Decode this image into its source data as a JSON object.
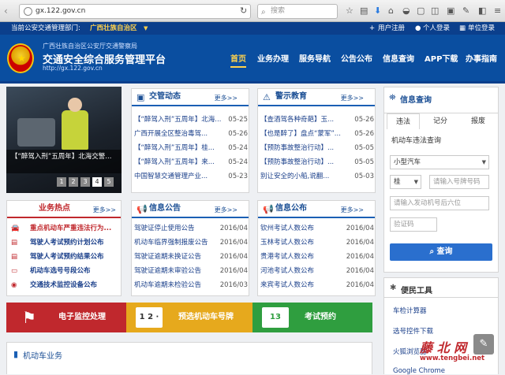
{
  "browser": {
    "url": "gx.122.gov.cn",
    "search_placeholder": "搜索"
  },
  "topbar": {
    "dept_label": "当前公安交通管理部门:",
    "dept_value": "广西壮族自治区",
    "register": "用户注册",
    "personal_login": "个人登录",
    "unit_login": "单位登录"
  },
  "header": {
    "org": "广西壮族自治区公安厅交通警察局",
    "title": "交通安全综合服务管理平台",
    "url": "http://gx.122.gov.cn"
  },
  "nav": [
    "首页",
    "业务办理",
    "服务导航",
    "公告公布",
    "信息查询",
    "APP下载",
    "办事指南"
  ],
  "slide": {
    "caption": "【“醉驾入刑”五周年】北海交警...",
    "pages": [
      "1",
      "2",
      "3",
      "4",
      "5"
    ],
    "active_page": "4"
  },
  "traffic_news": {
    "title": "交管动态",
    "more": "更多>>",
    "items": [
      {
        "text": "【“醉驾入刑”五周年】北海...",
        "date": "05-25"
      },
      {
        "text": "广西开展全区整治毒驾...",
        "date": "05-26"
      },
      {
        "text": "【“醉驾入刑”五周年】桂...",
        "date": "05-24"
      },
      {
        "text": "【“醉驾入刑”五周年】来...",
        "date": "05-24"
      },
      {
        "text": "中国智慧交通管理产业...",
        "date": "05-23"
      }
    ]
  },
  "warning_edu": {
    "title": "警示教育",
    "more": "更多>>",
    "items": [
      {
        "text": "【查酒驾各种奇葩】玉...",
        "date": "05-26"
      },
      {
        "text": "【也是醉了】盘点“蒙军”...",
        "date": "05-26"
      },
      {
        "text": "【预防事故整治行动】...",
        "date": "05-05"
      },
      {
        "text": "【预防事故整治行动】...",
        "date": "05-05"
      },
      {
        "text": "别让安全的小船,说翻...",
        "date": "05-03"
      }
    ]
  },
  "hot_business": {
    "title": "业务热点",
    "more": "更多>>",
    "items": [
      "重点机动车严重违法行为...",
      "驾驶人考试预约计划公布",
      "驾驶人考试预约结果公布",
      "机动车选号号段公布",
      "交通技术监控设备公布"
    ]
  },
  "info_notice": {
    "title": "信息公告",
    "more": "更多>>",
    "items": [
      {
        "text": "驾驶证停止使用公告",
        "date": "2016/04"
      },
      {
        "text": "机动车临界强制报废公告",
        "date": "2016/04"
      },
      {
        "text": "驾驶证逾期未换证公告",
        "date": "2016/04"
      },
      {
        "text": "驾驶证逾期未审验公告",
        "date": "2016/04"
      },
      {
        "text": "机动车逾期未检验公告",
        "date": "2016/03"
      }
    ]
  },
  "info_publish": {
    "title": "信息公布",
    "more": "更多>>",
    "items": [
      {
        "text": "钦州考试人数公布",
        "date": "2016/04"
      },
      {
        "text": "玉林考试人数公布",
        "date": "2016/04"
      },
      {
        "text": "贵港考试人数公布",
        "date": "2016/04"
      },
      {
        "text": "河池考试人数公布",
        "date": "2016/04"
      },
      {
        "text": "来宾考试人数公布",
        "date": "2016/04"
      }
    ]
  },
  "banners": [
    {
      "label": "电子监控处理",
      "color": "#c0282d",
      "icon": "flag-icon"
    },
    {
      "label": "预选机动车号牌",
      "color": "#e6a91d",
      "icon": "plate-icon",
      "icon_text": "1 2 ·"
    },
    {
      "label": "考试预约",
      "color": "#2f9e3f",
      "icon": "calendar-icon",
      "icon_text": "13"
    }
  ],
  "motor_business": {
    "title": "机动车业务"
  },
  "query": {
    "title": "信息查询",
    "tabs": [
      "违法",
      "记分",
      "报废"
    ],
    "subtitle": "机动车违法查询",
    "vehicle_type": "小型汽车",
    "province": "桂",
    "plate_placeholder": "请输入号牌号码",
    "engine_placeholder": "请输入发动机号后六位",
    "captcha_placeholder": "验证码",
    "submit": "查询"
  },
  "tools": {
    "title": "便民工具",
    "items": [
      "车检计算器",
      "选号控件下载",
      "火狐浏览器",
      "Google Chrome"
    ]
  },
  "watermark": {
    "brand": "藤 北 网",
    "site": "www.tengbei.net"
  },
  "colors": {
    "primary": "#0a4ea0",
    "red": "#c0282d",
    "yellow": "#e6a91d",
    "green": "#2f9e3f"
  }
}
